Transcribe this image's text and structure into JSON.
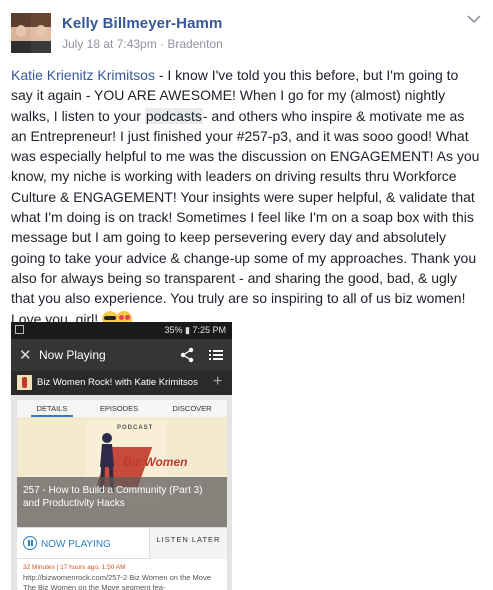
{
  "post": {
    "author": "Kelly Billmeyer-Hamm",
    "meta": "July 18 at 7:43pm · Bradenton",
    "mention": "Katie Krienitz Krimitsos",
    "text_before_link": " - I know I've told you this before, but I'm going to say it again - YOU ARE AWESOME! When I go for my (almost) nightly walks, I listen to your ",
    "link_word": "podcasts",
    "text_after_link": "- and others who inspire & motivate me as an Entrepreneur! I just finished your #257-p3, and it was sooo good! What was especially helpful to me was the discussion on ENGAGEMENT! As you know, my niche is working with leaders on driving results thru Workforce Culture & ENGAGEMENT! Your insights were super helpful, & validate that what I'm doing is on track! Sometimes I feel like I'm on a soap box with this message but I am going to keep persevering every day and absolutely going to take your advice & change-up some of my approaches. Thank you also for always being so transparent - and sharing the good, bad, & ugly that you also experience. You truly are so inspiring to all of us biz women! Love you, girl! ",
    "emoji": [
      "smiling-face-with-sunglasses",
      "smiling-face-with-heart-eyes"
    ]
  },
  "phone": {
    "status": "35% ▮ 7:25 PM",
    "app_title": "Now Playing",
    "podcast_name": "Biz Women Rock! with Katie Krimitsos",
    "tabs": [
      "DETAILS",
      "EPISODES",
      "DISCOVER"
    ],
    "art_word": "PODCAST",
    "art_logo": "Biz Women",
    "episode_title": "257 - How to Build a Community (Part 3) and Productivity Hacks",
    "now_playing": "NOW PLAYING",
    "listen_later": "LISTEN LATER",
    "episode_meta": "32 Minutes | 17 hours ago, 1:50 AM",
    "episode_desc": "http://bizwomenrock.com/257-2 Biz Women on the Move The Biz Women on the Move segment fea-"
  },
  "colors": {
    "link": "#365899",
    "meta": "#90949c",
    "accent": "#2a7fc0"
  }
}
